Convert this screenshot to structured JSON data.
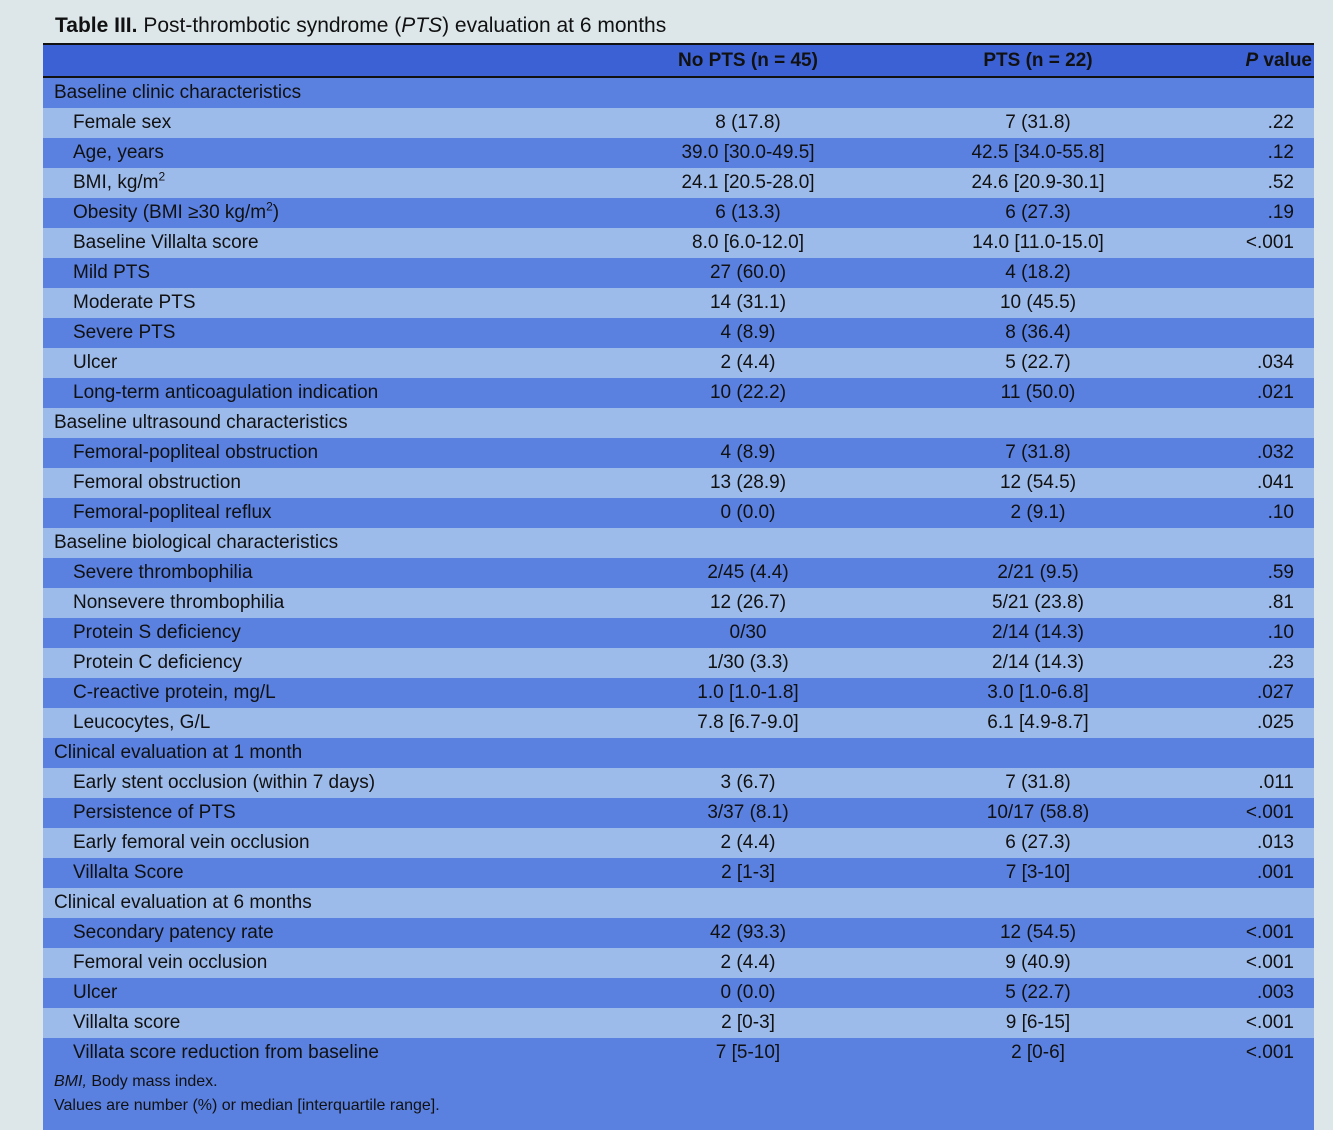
{
  "title": {
    "lead": "Table III.",
    "text_before": "Post-thrombotic syndrome (",
    "text_italic": "PTS",
    "text_after": ") evaluation at 6 months"
  },
  "headers": {
    "col1": "No PTS (n = 45)",
    "col2": "PTS (n = 22)",
    "col3_italic": "P",
    "col3_rest": "value"
  },
  "rows": [
    {
      "type": "section",
      "label": "Baseline clinic characteristics"
    },
    {
      "label": "Female sex",
      "v1": "8 (17.8)",
      "v2": "7 (31.8)",
      "p": ".22"
    },
    {
      "label": "Age, years",
      "v1": "39.0 [30.0-49.5]",
      "v2": "42.5 [34.0-55.8]",
      "p": ".12"
    },
    {
      "label": "BMI, kg/m",
      "sup": "2",
      "v1": "24.1 [20.5-28.0]",
      "v2": "24.6 [20.9-30.1]",
      "p": ".52"
    },
    {
      "label": "Obesity (BMI ≥30 kg/m",
      "sup": "2",
      "suffix": ")",
      "v1": "6 (13.3)",
      "v2": "6 (27.3)",
      "p": ".19"
    },
    {
      "label": "Baseline Villalta score",
      "v1": "8.0 [6.0-12.0]",
      "v2": "14.0 [11.0-15.0]",
      "p": "<.001"
    },
    {
      "label": "Mild PTS",
      "v1": "27 (60.0)",
      "v2": "4 (18.2)",
      "p": ""
    },
    {
      "label": "Moderate PTS",
      "v1": "14 (31.1)",
      "v2": "10 (45.5)",
      "p": ""
    },
    {
      "label": "Severe PTS",
      "v1": "4 (8.9)",
      "v2": "8 (36.4)",
      "p": ""
    },
    {
      "label": "Ulcer",
      "v1": "2 (4.4)",
      "v2": "5 (22.7)",
      "p": ".034"
    },
    {
      "label": "Long-term anticoagulation indication",
      "v1": "10 (22.2)",
      "v2": "11 (50.0)",
      "p": ".021"
    },
    {
      "type": "section",
      "label": "Baseline ultrasound characteristics"
    },
    {
      "label": "Femoral-popliteal obstruction",
      "v1": "4 (8.9)",
      "v2": "7 (31.8)",
      "p": ".032"
    },
    {
      "label": "Femoral obstruction",
      "v1": "13 (28.9)",
      "v2": "12 (54.5)",
      "p": ".041"
    },
    {
      "label": "Femoral-popliteal reflux",
      "v1": "0 (0.0)",
      "v2": "2 (9.1)",
      "p": ".10"
    },
    {
      "type": "section",
      "label": "Baseline biological characteristics"
    },
    {
      "label": "Severe thrombophilia",
      "v1": "2/45 (4.4)",
      "v2": "2/21 (9.5)",
      "p": ".59"
    },
    {
      "label": "Nonsevere thrombophilia",
      "v1": "12 (26.7)",
      "v2": "5/21 (23.8)",
      "p": ".81"
    },
    {
      "label": "Protein S deficiency",
      "v1": "0/30",
      "v2": "2/14 (14.3)",
      "p": ".10"
    },
    {
      "label": "Protein C deficiency",
      "v1": "1/30 (3.3)",
      "v2": "2/14 (14.3)",
      "p": ".23"
    },
    {
      "label": "C-reactive protein, mg/L",
      "v1": "1.0 [1.0-1.8]",
      "v2": "3.0 [1.0-6.8]",
      "p": ".027"
    },
    {
      "label": "Leucocytes, G/L",
      "v1": "7.8 [6.7-9.0]",
      "v2": "6.1 [4.9-8.7]",
      "p": ".025"
    },
    {
      "type": "section",
      "label": "Clinical evaluation at 1 month"
    },
    {
      "label": "Early stent occlusion (within 7 days)",
      "v1": "3 (6.7)",
      "v2": "7 (31.8)",
      "p": ".011"
    },
    {
      "label": "Persistence of PTS",
      "v1": "3/37 (8.1)",
      "v2": "10/17 (58.8)",
      "p": "<.001"
    },
    {
      "label": "Early femoral vein occlusion",
      "v1": "2 (4.4)",
      "v2": "6 (27.3)",
      "p": ".013"
    },
    {
      "label": "Villalta Score",
      "v1": "2 [1-3]",
      "v2": "7 [3-10]",
      "p": ".001"
    },
    {
      "type": "section",
      "label": "Clinical evaluation at 6 months"
    },
    {
      "label": "Secondary patency rate",
      "v1": "42 (93.3)",
      "v2": "12 (54.5)",
      "p": "<.001"
    },
    {
      "label": "Femoral vein occlusion",
      "v1": "2 (4.4)",
      "v2": "9 (40.9)",
      "p": "<.001"
    },
    {
      "label": "Ulcer",
      "v1": "0 (0.0)",
      "v2": "5 (22.7)",
      "p": ".003"
    },
    {
      "label": "Villalta score",
      "v1": "2 [0-3]",
      "v2": "9 [6-15]",
      "p": "<.001"
    },
    {
      "label": "Villata score reduction from baseline",
      "v1": "7 [5-10]",
      "v2": "2 [0-6]",
      "p": "<.001"
    }
  ],
  "footnotes": {
    "abbr_italic": "BMI,",
    "abbr_text": " Body mass index.",
    "values_note": "Values are number (%) or median [interquartile range]."
  },
  "colors": {
    "header": "#3c61d4",
    "row_dark": "#5a80e0",
    "row_light": "#9dbbea",
    "background": "#dde7ea"
  }
}
